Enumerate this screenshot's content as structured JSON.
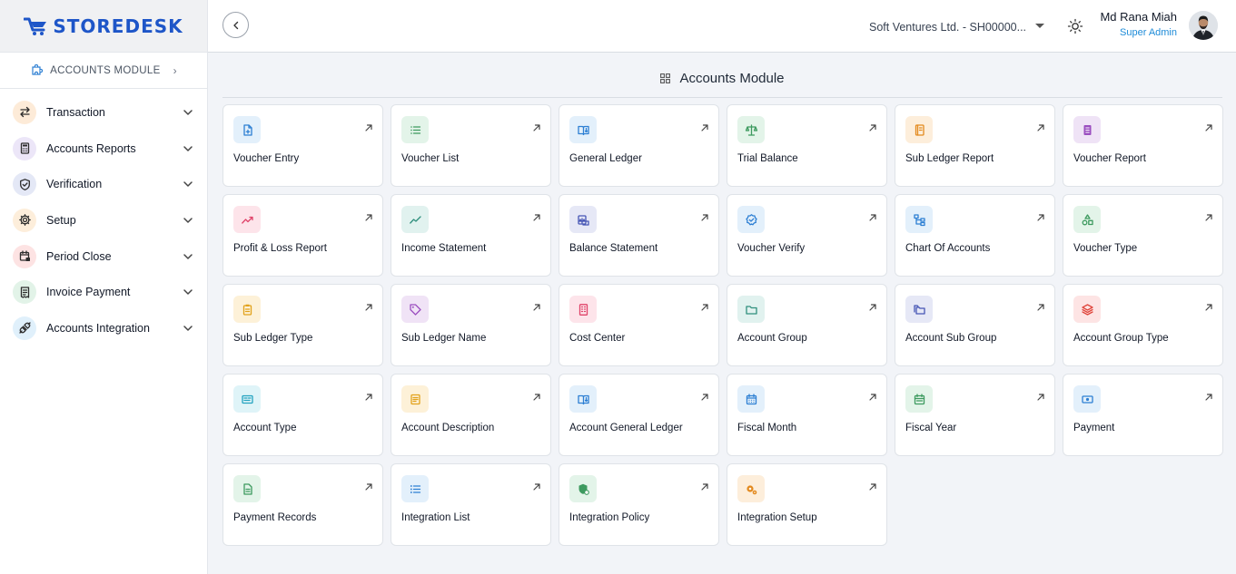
{
  "brand": {
    "name": "STOREDESK"
  },
  "sidebar": {
    "module_label": "ACCOUNTS MODULE",
    "items": [
      {
        "label": "Transaction",
        "icon": "transfer-icon",
        "bg": "#fdebd8",
        "fg": "#2c2c2c"
      },
      {
        "label": "Accounts Reports",
        "icon": "calculator-icon",
        "bg": "#ece6f8",
        "fg": "#2c2c2c"
      },
      {
        "label": "Verification",
        "icon": "shield-check-icon",
        "bg": "#e4e8f6",
        "fg": "#2c2c2c"
      },
      {
        "label": "Setup",
        "icon": "gear-icon",
        "bg": "#fdeedb",
        "fg": "#2c2c2c"
      },
      {
        "label": "Period Close",
        "icon": "calendar-lock-icon",
        "bg": "#fde3e3",
        "fg": "#2c2c2c"
      },
      {
        "label": "Invoice Payment",
        "icon": "invoice-icon",
        "bg": "#e2f3e8",
        "fg": "#2c2c2c"
      },
      {
        "label": "Accounts Integration",
        "icon": "plug-icon",
        "bg": "#e0f0fb",
        "fg": "#2c2c2c"
      }
    ]
  },
  "header": {
    "company": "Soft Ventures Ltd. - SH00000...",
    "user_name": "Md Rana Miah",
    "user_role": "Super Admin"
  },
  "main": {
    "title": "Accounts Module",
    "cards": [
      {
        "label": "Voucher Entry",
        "icon": "file-plus-icon",
        "bg": "#e3f0fb",
        "fg": "#2d7fd3"
      },
      {
        "label": "Voucher List",
        "icon": "list-icon",
        "bg": "#e3f4e9",
        "fg": "#3d9a5f"
      },
      {
        "label": "General Ledger",
        "icon": "book-open-icon",
        "bg": "#e3f0fb",
        "fg": "#2d7fd3"
      },
      {
        "label": "Trial Balance",
        "icon": "scale-icon",
        "bg": "#e3f4e9",
        "fg": "#3d9a5f"
      },
      {
        "label": "Sub Ledger Report",
        "icon": "notebook-icon",
        "bg": "#fdeedb",
        "fg": "#e38a1f"
      },
      {
        "label": "Voucher Report",
        "icon": "document-lines-icon",
        "bg": "#efe3f6",
        "fg": "#9b4fc0"
      },
      {
        "label": "Profit & Loss Report",
        "icon": "trend-up-icon",
        "bg": "#fde4ea",
        "fg": "#e0446a"
      },
      {
        "label": "Income Statement",
        "icon": "line-chart-icon",
        "bg": "#e1f2ef",
        "fg": "#2f8f7d"
      },
      {
        "label": "Balance Statement",
        "icon": "balance-scale-icon",
        "bg": "#e6e8f6",
        "fg": "#4656b5"
      },
      {
        "label": "Voucher Verify",
        "icon": "verified-badge-icon",
        "bg": "#e3f0fb",
        "fg": "#2d7fd3"
      },
      {
        "label": "Chart Of Accounts",
        "icon": "tree-chart-icon",
        "bg": "#e3f0fb",
        "fg": "#2d7fd3"
      },
      {
        "label": "Voucher Type",
        "icon": "shapes-icon",
        "bg": "#e3f4e9",
        "fg": "#3d9a5f"
      },
      {
        "label": "Sub Ledger Type",
        "icon": "clipboard-icon",
        "bg": "#fdf1d8",
        "fg": "#e2a21b"
      },
      {
        "label": "Sub Ledger Name",
        "icon": "tag-icon",
        "bg": "#f0e3f6",
        "fg": "#9b4fc0"
      },
      {
        "label": "Cost Center",
        "icon": "building-icon",
        "bg": "#fde4ea",
        "fg": "#e0446a"
      },
      {
        "label": "Account Group",
        "icon": "folder-icon",
        "bg": "#e1f2ef",
        "fg": "#2f8f7d"
      },
      {
        "label": "Account Sub Group",
        "icon": "folders-icon",
        "bg": "#e6e8f6",
        "fg": "#4656b5"
      },
      {
        "label": "Account Group Type",
        "icon": "layers-icon",
        "bg": "#fde4e4",
        "fg": "#e0463c"
      },
      {
        "label": "Account Type",
        "icon": "id-card-icon",
        "bg": "#dff4f8",
        "fg": "#24a3c0"
      },
      {
        "label": "Account Description",
        "icon": "description-icon",
        "bg": "#fdf1d8",
        "fg": "#e2a21b"
      },
      {
        "label": "Account General Ledger",
        "icon": "book-open-icon",
        "bg": "#e3f0fb",
        "fg": "#2d7fd3"
      },
      {
        "label": "Fiscal Month",
        "icon": "calendar-icon",
        "bg": "#e3f0fb",
        "fg": "#2d7fd3"
      },
      {
        "label": "Fiscal Year",
        "icon": "calendar-year-icon",
        "bg": "#e3f4e9",
        "fg": "#3d9a5f"
      },
      {
        "label": "Payment",
        "icon": "cash-icon",
        "bg": "#e3f0fb",
        "fg": "#2d7fd3"
      },
      {
        "label": "Payment Records",
        "icon": "receipt-icon",
        "bg": "#e3f4e9",
        "fg": "#3d9a5f"
      },
      {
        "label": "Integration List",
        "icon": "bullet-list-icon",
        "bg": "#e3f0fb",
        "fg": "#2d7fd3"
      },
      {
        "label": "Integration Policy",
        "icon": "shield-gear-icon",
        "bg": "#e3f4e9",
        "fg": "#3d9a5f"
      },
      {
        "label": "Integration Setup",
        "icon": "gears-icon",
        "bg": "#fdeedb",
        "fg": "#e38a1f"
      }
    ]
  }
}
